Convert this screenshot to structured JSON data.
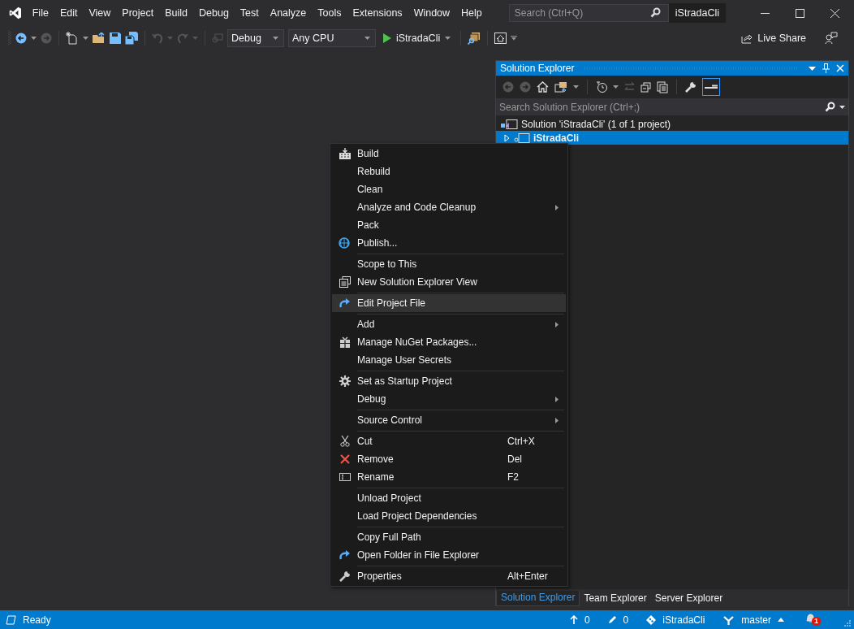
{
  "window": {
    "title": "iStradaCli"
  },
  "menu_bar": [
    "File",
    "Edit",
    "View",
    "Project",
    "Build",
    "Debug",
    "Test",
    "Analyze",
    "Tools",
    "Extensions",
    "Window",
    "Help"
  ],
  "search": {
    "placeholder": "Search (Ctrl+Q)"
  },
  "toolbar": {
    "configuration": "Debug",
    "platform": "Any CPU",
    "start_target": "iStradaCli",
    "live_share": "Live Share"
  },
  "solution_explorer": {
    "title": "Solution Explorer",
    "search": {
      "placeholder": "Search Solution Explorer (Ctrl+;)"
    },
    "tree": [
      {
        "label": "Solution 'iStradaCli' (1 of 1 project)",
        "selected": false,
        "children": [
          {
            "label": "iStradaCli",
            "selected": true,
            "expanded": false
          }
        ]
      }
    ],
    "bottom_tabs": [
      {
        "label": "Solution Explorer",
        "selected": true
      },
      {
        "label": "Team Explorer",
        "selected": false
      },
      {
        "label": "Server Explorer",
        "selected": false
      }
    ]
  },
  "context_menu": {
    "groups": [
      {
        "items": [
          {
            "label": "Build",
            "submenu": false,
            "selected": false
          },
          {
            "label": "Rebuild",
            "submenu": false,
            "selected": false
          },
          {
            "label": "Clean",
            "submenu": false,
            "selected": false
          },
          {
            "label": "Analyze and Code Cleanup",
            "submenu": true,
            "selected": false
          },
          {
            "label": "Pack",
            "submenu": false,
            "selected": false
          },
          {
            "label": "Publish...",
            "submenu": false,
            "selected": false
          }
        ]
      },
      {
        "items": [
          {
            "label": "Scope to This",
            "submenu": false,
            "selected": false
          },
          {
            "label": "New Solution Explorer View",
            "submenu": false,
            "selected": false
          }
        ]
      },
      {
        "items": [
          {
            "label": "Edit Project File",
            "submenu": false,
            "selected": true
          }
        ]
      },
      {
        "items": [
          {
            "label": "Add",
            "submenu": true,
            "selected": false
          },
          {
            "label": "Manage NuGet Packages...",
            "submenu": false,
            "selected": false
          },
          {
            "label": "Manage User Secrets",
            "submenu": false,
            "selected": false
          }
        ]
      },
      {
        "items": [
          {
            "label": "Set as Startup Project",
            "submenu": false,
            "selected": false
          },
          {
            "label": "Debug",
            "submenu": true,
            "selected": false
          }
        ]
      },
      {
        "items": [
          {
            "label": "Source Control",
            "submenu": true,
            "selected": false
          }
        ]
      },
      {
        "items": [
          {
            "label": "Cut",
            "shortcut": "Ctrl+X",
            "submenu": false,
            "selected": false
          },
          {
            "label": "Remove",
            "shortcut": "Del",
            "submenu": false,
            "selected": false
          },
          {
            "label": "Rename",
            "shortcut": "F2",
            "submenu": false,
            "selected": false
          }
        ]
      },
      {
        "items": [
          {
            "label": "Unload Project",
            "submenu": false,
            "selected": false
          },
          {
            "label": "Load Project Dependencies",
            "submenu": false,
            "selected": false
          }
        ]
      },
      {
        "items": [
          {
            "label": "Copy Full Path",
            "submenu": false,
            "selected": false
          },
          {
            "label": "Open Folder in File Explorer",
            "submenu": false,
            "selected": false
          }
        ]
      },
      {
        "items": [
          {
            "label": "Properties",
            "shortcut": "Alt+Enter",
            "submenu": false,
            "selected": false
          }
        ]
      }
    ]
  },
  "status_bar": {
    "message": "Ready",
    "incoming": "0",
    "changes": "0",
    "repository": "iStradaCli",
    "branch": "master",
    "notifications": "1"
  }
}
